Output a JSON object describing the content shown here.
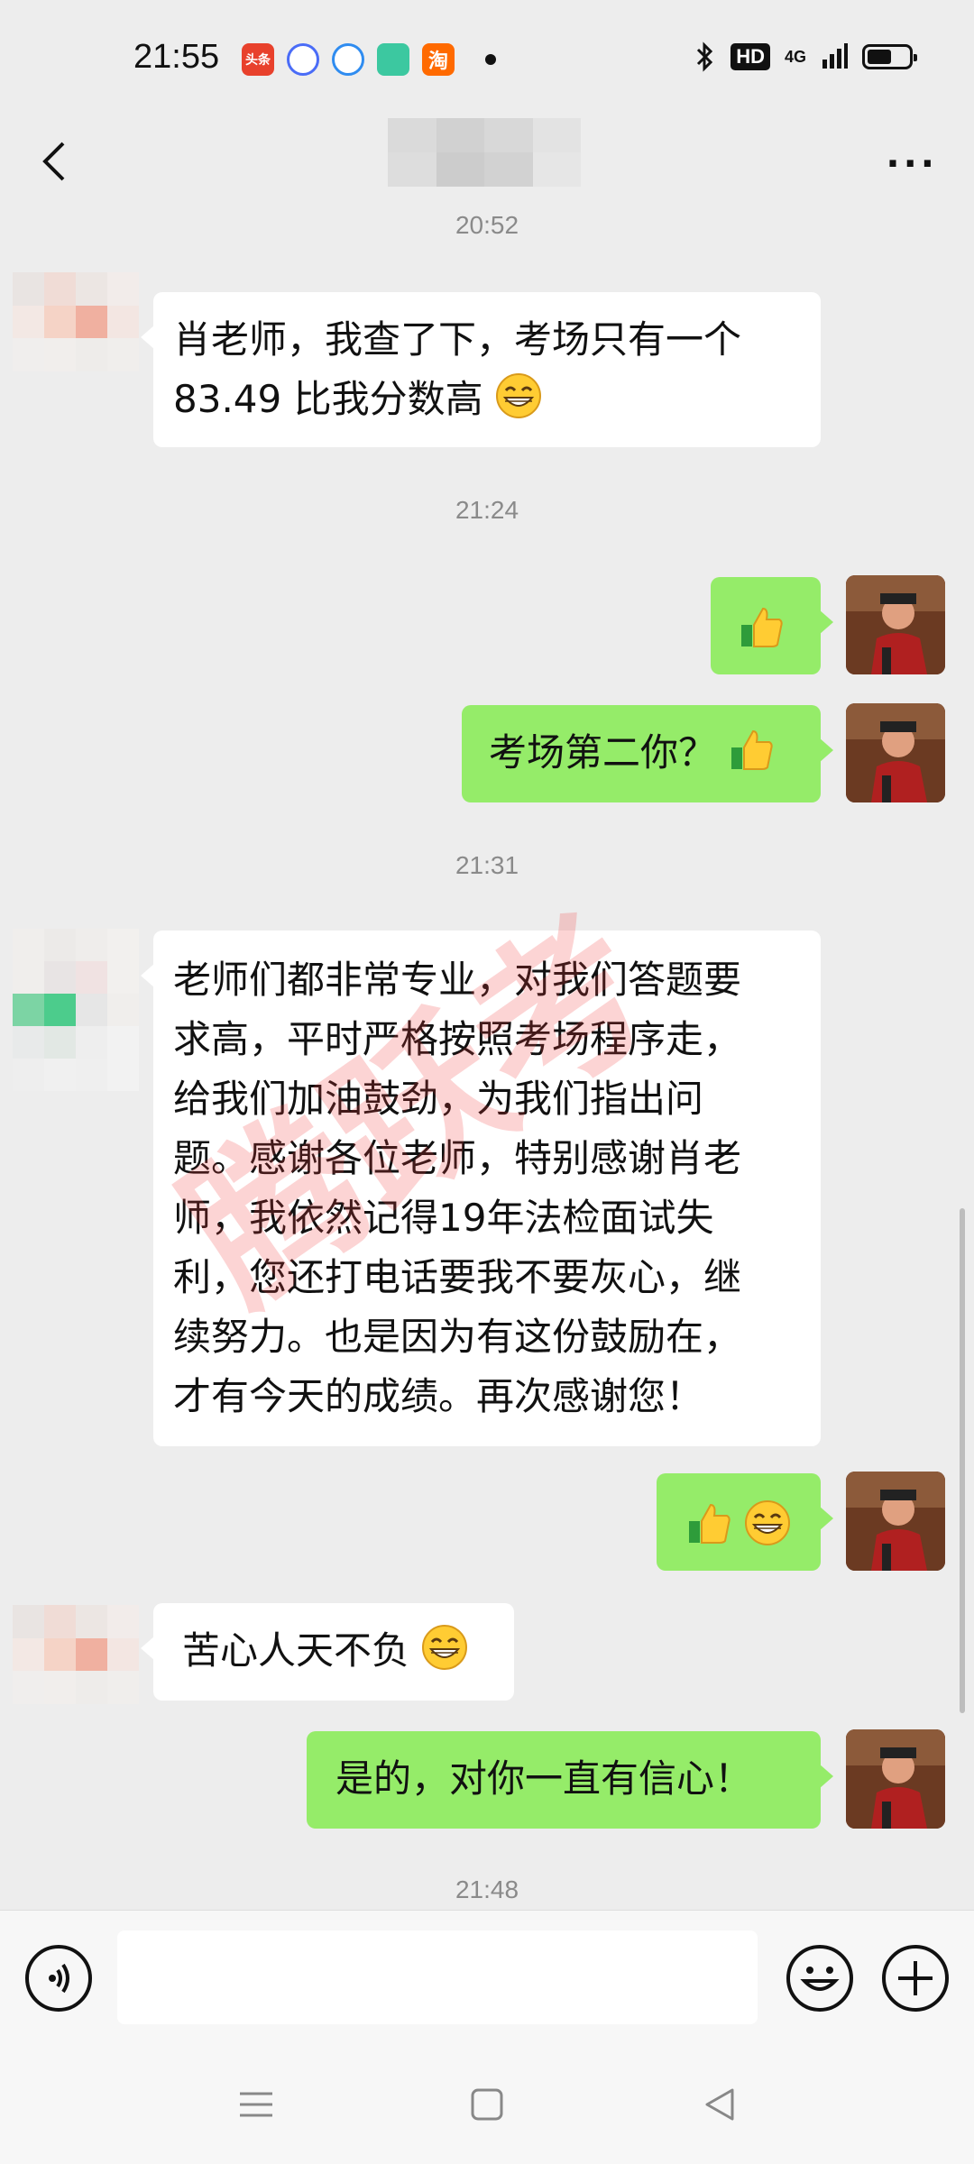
{
  "status_bar": {
    "time": "21:55",
    "apps": [
      {
        "name": "toutiao-icon",
        "label": "头条",
        "color": "#e8412c"
      },
      {
        "name": "app-icon-2",
        "label": "",
        "color": "#4a6cf7"
      },
      {
        "name": "app-icon-3",
        "label": "",
        "color": "#2f8cf0"
      },
      {
        "name": "app-icon-4",
        "label": "",
        "color": "#3cc8a0"
      },
      {
        "name": "taobao-icon",
        "label": "淘",
        "color": "#ff6a00"
      }
    ],
    "hd": "HD",
    "network": "4G"
  },
  "header": {
    "more": "···"
  },
  "messages": [
    {
      "type": "time",
      "text": "20:52"
    },
    {
      "type": "left",
      "text": "肖老师，我查了下，考场只有一个83.49 比我分数高",
      "emoji": "grin"
    },
    {
      "type": "time",
      "text": "21:24"
    },
    {
      "type": "right",
      "text": "",
      "emoji": "thumbs"
    },
    {
      "type": "right",
      "text": "考场第二你？",
      "emoji": "thumbs"
    },
    {
      "type": "time",
      "text": "21:31"
    },
    {
      "type": "left",
      "text": "老师们都非常专业，对我们答题要求高，平时严格按照考场程序走，给我们加油鼓劲，为我们指出问题。感谢各位老师，特别感谢肖老师，我依然记得19年法检面试失利，您还打电话要我不要灰心，继续努力。也是因为有这份鼓励在，才有今天的成绩。再次感谢您！"
    },
    {
      "type": "right",
      "text": "",
      "emoji": "thumbs+grin"
    },
    {
      "type": "left",
      "text": "苦心人天不负",
      "emoji": "grin"
    },
    {
      "type": "right",
      "text": "是的，对你一直有信心！"
    },
    {
      "type": "time",
      "text": "21:48"
    }
  ],
  "chat": {
    "time1": "20:52",
    "msg1_line1": "肖老师，我查了下，考场只有一个",
    "msg1_line2": "83.49 比我分数高",
    "time2": "21:24",
    "msg3": "考场第二你？",
    "time3": "21:31",
    "msg4_lines": [
      "老师们都非常专业，对我们答题要",
      "求高，平时严格按照考场程序走，",
      "给我们加油鼓劲，为我们指出问",
      "题。感谢各位老师，特别感谢肖老",
      "师，我依然记得19年法检面试失",
      "利，您还打电话要我不要灰心，继",
      "续努力。也是因为有这份鼓励在，",
      "才有今天的成绩。再次感谢您！"
    ],
    "msg6": "苦心人天不负",
    "msg7": "是的，对你一直有信心！",
    "time4": "21:48"
  },
  "watermark": "腾跃考",
  "input": {
    "placeholder": ""
  },
  "colors": {
    "bubble_me": "#95ec69",
    "bubble_other": "#ffffff",
    "background": "#ededed"
  }
}
